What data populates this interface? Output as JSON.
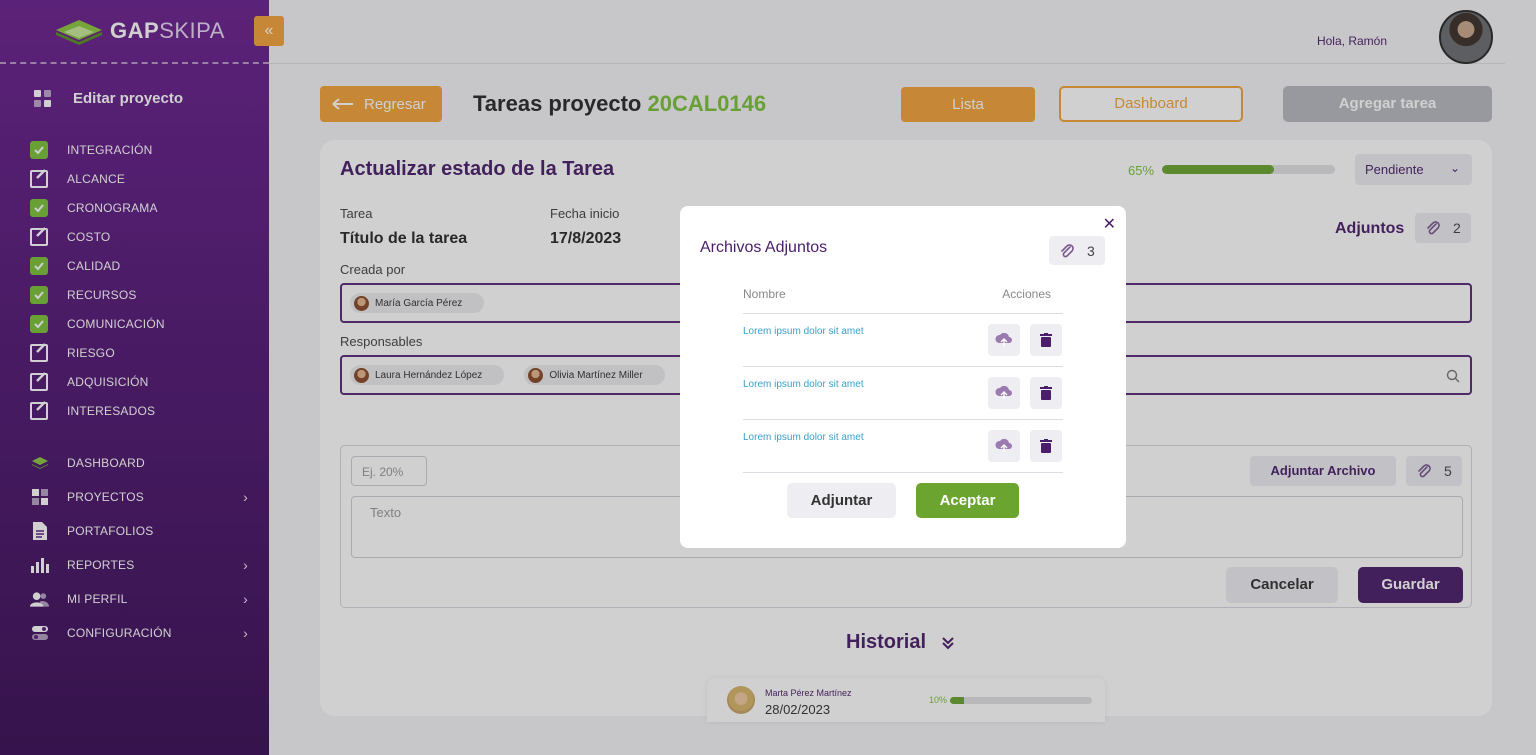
{
  "brand": {
    "name_bold": "GAP",
    "name_light": "SKIPA",
    "collapse_icon": "double-chevron-left-icon"
  },
  "sidebar": {
    "project_title": "Editar proyecto",
    "phases": [
      {
        "label": "INTEGRACIÓN",
        "status": "complete"
      },
      {
        "label": "ALCANCE",
        "status": "edit"
      },
      {
        "label": "CRONOGRAMA",
        "status": "complete"
      },
      {
        "label": "COSTO",
        "status": "edit"
      },
      {
        "label": "CALIDAD",
        "status": "complete"
      },
      {
        "label": "RECURSOS",
        "status": "complete"
      },
      {
        "label": "COMUNICACIÓN",
        "status": "complete"
      },
      {
        "label": "RIESGO",
        "status": "edit"
      },
      {
        "label": "ADQUISICIÓN",
        "status": "edit"
      },
      {
        "label": "INTERESADOS",
        "status": "edit"
      }
    ],
    "nav": [
      {
        "label": "DASHBOARD",
        "icon": "layers-icon",
        "has_submenu": false
      },
      {
        "label": "PROYECTOS",
        "icon": "grid-icon",
        "has_submenu": true
      },
      {
        "label": "PORTAFOLIOS",
        "icon": "document-icon",
        "has_submenu": false
      },
      {
        "label": "REPORTES",
        "icon": "bar-chart-icon",
        "has_submenu": true
      },
      {
        "label": "MI PERFIL",
        "icon": "users-icon",
        "has_submenu": true
      },
      {
        "label": "CONFIGURACIÓN",
        "icon": "toggle-icon",
        "has_submenu": true
      }
    ]
  },
  "topbar": {
    "greeting": "Hola, Ramón"
  },
  "header": {
    "back_label": "Regresar",
    "title_prefix": "Tareas proyecto",
    "project_code": "20CAL0146",
    "list_label": "Lista",
    "dashboard_label": "Dashboard",
    "add_task_label": "Agregar tarea"
  },
  "task_card": {
    "title": "Actualizar estado de la  Tarea",
    "progress_text": "65%",
    "progress": 0.65,
    "status": "Pendiente",
    "task_label": "Tarea",
    "task_value": "Título de la tarea",
    "start_label": "Fecha inicio",
    "start_value": "17/8/2023",
    "attachments_label": "Adjuntos",
    "attachments_count": "2",
    "created_by_label": "Creada por",
    "created_by": [
      "María García Pérez"
    ],
    "responsibles_label": "Responsables",
    "responsibles": [
      "Laura Hernández López",
      "Olivia Martínez Miller"
    ]
  },
  "update_form": {
    "percent_placeholder": "Ej. 20%",
    "attach_file_label": "Adjuntar Archivo",
    "attach_count": "5",
    "text_placeholder": "Texto",
    "cancel_label": "Cancelar",
    "save_label": "Guardar"
  },
  "history": {
    "title": "Historial",
    "items": [
      {
        "name": "Marta Pérez Martínez",
        "date": "28/02/2023",
        "progress_text": "10%",
        "progress": 0.1
      }
    ]
  },
  "modal": {
    "title": "Archivos Adjuntos",
    "count": "3",
    "col_name": "Nombre",
    "col_actions": "Acciones",
    "files": [
      {
        "name": "Lorem ipsum dolor sit amet"
      },
      {
        "name": "Lorem ipsum dolor sit amet"
      },
      {
        "name": "Lorem ipsum dolor sit amet"
      }
    ],
    "attach_label": "Adjuntar",
    "accept_label": "Aceptar"
  },
  "colors": {
    "purple": "#4a1e6a",
    "orange": "#f2a33a",
    "green": "#6ba52f",
    "link": "#3aa0c8"
  }
}
